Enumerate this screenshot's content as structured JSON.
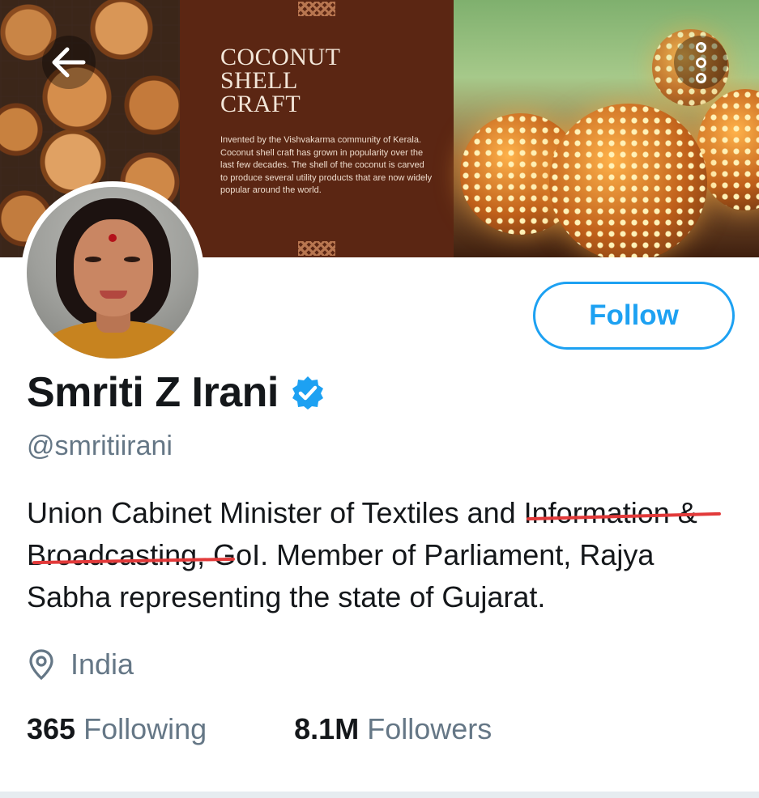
{
  "banner": {
    "title": "COCONUT\nSHELL\nCRAFT",
    "text": "Invented by the Vishvakarma community of Kerala. Coconut shell craft has grown in popularity over the last few decades. The shell of the coconut is carved to produce several utility products that are now widely popular around the world."
  },
  "actions": {
    "follow_label": "Follow",
    "back_icon": "back-arrow-icon",
    "more_icon": "more-vertical-icon"
  },
  "profile": {
    "name": "Smriti Z Irani",
    "verified": true,
    "handle": "@smritiirani",
    "bio": "Union Cabinet Minister of Textiles and Information & Broadcasting, GoI. Member of Parliament, Rajya Sabha representing the state of Gujarat.",
    "location": "India"
  },
  "stats": {
    "following_count": "365",
    "following_label": "Following",
    "followers_count": "8.1M",
    "followers_label": "Followers"
  },
  "colors": {
    "accent": "#1da1f2",
    "secondary_text": "#657786",
    "primary_text": "#14171a",
    "annotation": "#e23a3a"
  }
}
